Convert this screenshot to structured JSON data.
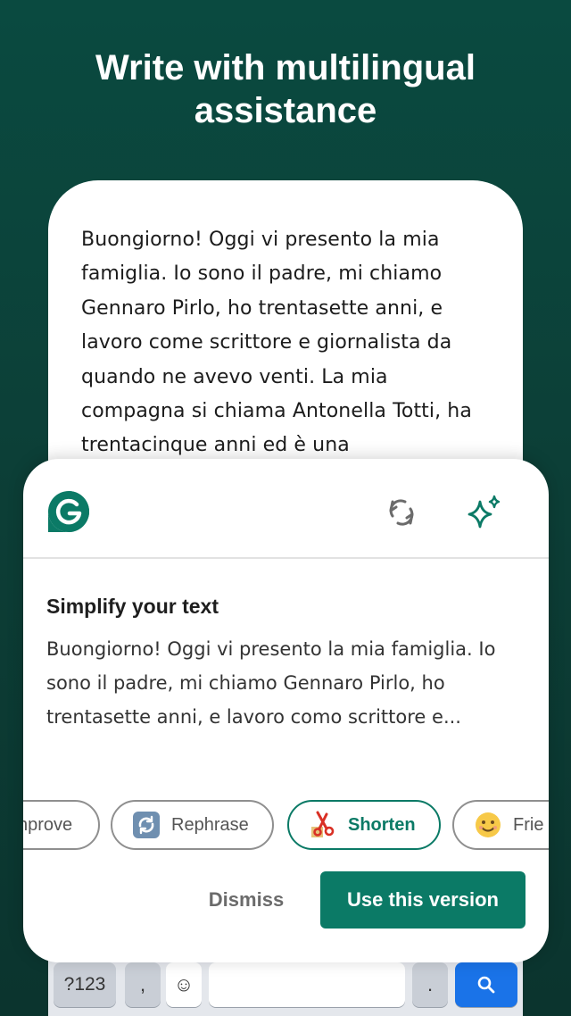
{
  "headline": "Write with multilingual assistance",
  "document": {
    "text": "Buongiorno! Oggi vi presento la mia famiglia. Io sono il padre, mi chiamo Gennaro Pirlo, ho trentasette anni, e lavoro come scrittore e giornalista da quando ne avevo venti. La mia compagna si chiama Antonella Totti, ha trentacinque anni ed è una"
  },
  "panel": {
    "title": "Simplify your text",
    "suggestion": "Buongiorno! Oggi vi presento la mia famiglia. Io sono il padre, mi chiamo Gennaro Pirlo, ho trentasette anni, e lavoro como scrittore e...",
    "header_icons": [
      "grammarly-logo-icon",
      "refresh-icon",
      "sparkle-icon"
    ],
    "chips": [
      {
        "label": "nprove",
        "icon": ""
      },
      {
        "label": "Rephrase",
        "icon": "rephrase-icon"
      },
      {
        "label": "Shorten",
        "icon": "scissors-icon",
        "active": true
      },
      {
        "label": "Frie",
        "icon": "smile-icon"
      }
    ],
    "dismiss_label": "Dismiss",
    "use_label": "Use this version"
  },
  "keyboard": {
    "keys": [
      "?123",
      ",",
      "☺",
      "",
      ".",
      "search-icon"
    ]
  },
  "colors": {
    "background": "#0c3f37",
    "accent": "#0b7a66",
    "search_key": "#1a73e8"
  }
}
